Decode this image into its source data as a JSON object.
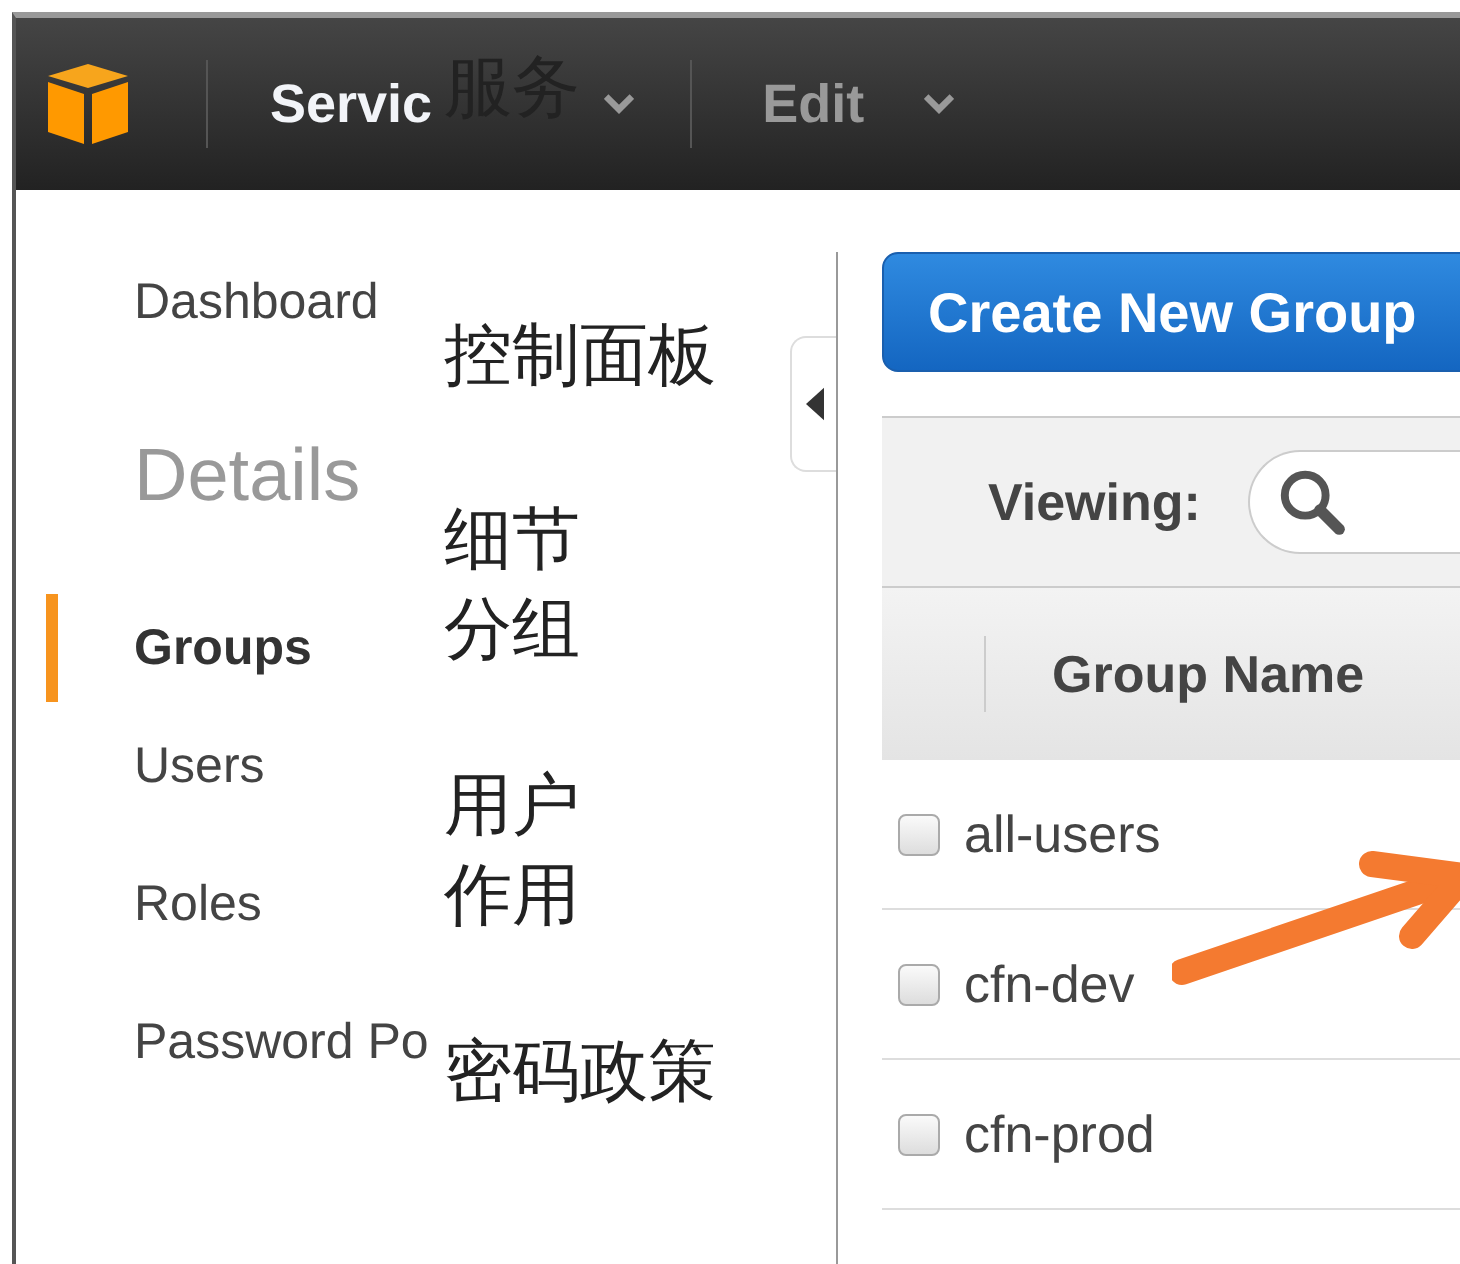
{
  "navbar": {
    "menus": [
      {
        "label": "Servic",
        "highlighted": true
      },
      {
        "label": "Edit",
        "highlighted": false
      }
    ]
  },
  "sidebar": {
    "items": [
      {
        "kind": "link",
        "label": "Dashboard",
        "selected": false
      },
      {
        "kind": "heading",
        "label": "Details"
      },
      {
        "kind": "link",
        "label": "Groups",
        "selected": true
      },
      {
        "kind": "link",
        "label": "Users",
        "selected": false
      },
      {
        "kind": "link",
        "label": "Roles",
        "selected": false
      },
      {
        "kind": "link",
        "label": "Password Po",
        "selected": false
      }
    ]
  },
  "main": {
    "create_button": "Create New Group",
    "toolbar": {
      "label": "Viewing:"
    },
    "table": {
      "columns": [
        "Group Name"
      ],
      "rows": [
        {
          "name": "all-users",
          "checked": false
        },
        {
          "name": "cfn-dev",
          "checked": false
        },
        {
          "name": "cfn-prod",
          "checked": false
        }
      ]
    }
  },
  "annotations": [
    {
      "text": "服务"
    },
    {
      "text": "控制面板"
    },
    {
      "text": "细节"
    },
    {
      "text": "分组"
    },
    {
      "text": "用户"
    },
    {
      "text": "作用"
    },
    {
      "text": "密码政策"
    }
  ]
}
